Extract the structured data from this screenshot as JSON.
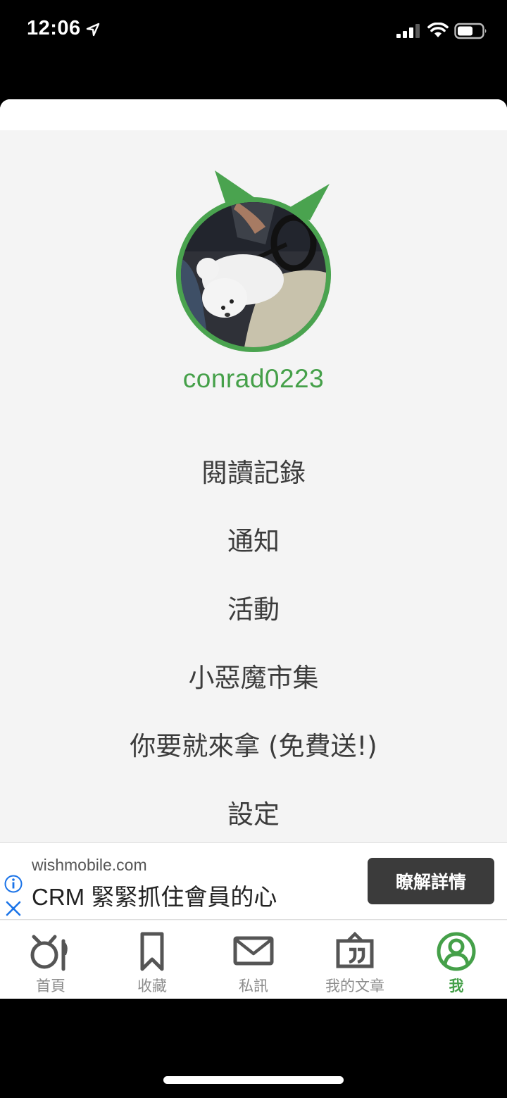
{
  "status_bar": {
    "time": "12:06"
  },
  "profile": {
    "username": "conrad0223"
  },
  "menu": [
    {
      "label": "閱讀記錄"
    },
    {
      "label": "通知"
    },
    {
      "label": "活動"
    },
    {
      "label": "小惡魔市集"
    },
    {
      "label": "你要就來拿 (免費送!)"
    },
    {
      "label": "設定"
    }
  ],
  "ad": {
    "domain": "wishmobile.com",
    "title": "CRM 緊緊抓住會員的心",
    "cta": "瞭解詳情"
  },
  "tabs": [
    {
      "label": "首頁",
      "icon": "home-pot-icon"
    },
    {
      "label": "收藏",
      "icon": "bookmark-icon"
    },
    {
      "label": "私訊",
      "icon": "mail-icon"
    },
    {
      "label": "我的文章",
      "icon": "quote-board-icon"
    },
    {
      "label": "我",
      "icon": "profile-icon",
      "active": true
    }
  ],
  "colors": {
    "accent": "#45a049",
    "ad_button": "#3b3b3b",
    "info_blue": "#1a73e8"
  }
}
